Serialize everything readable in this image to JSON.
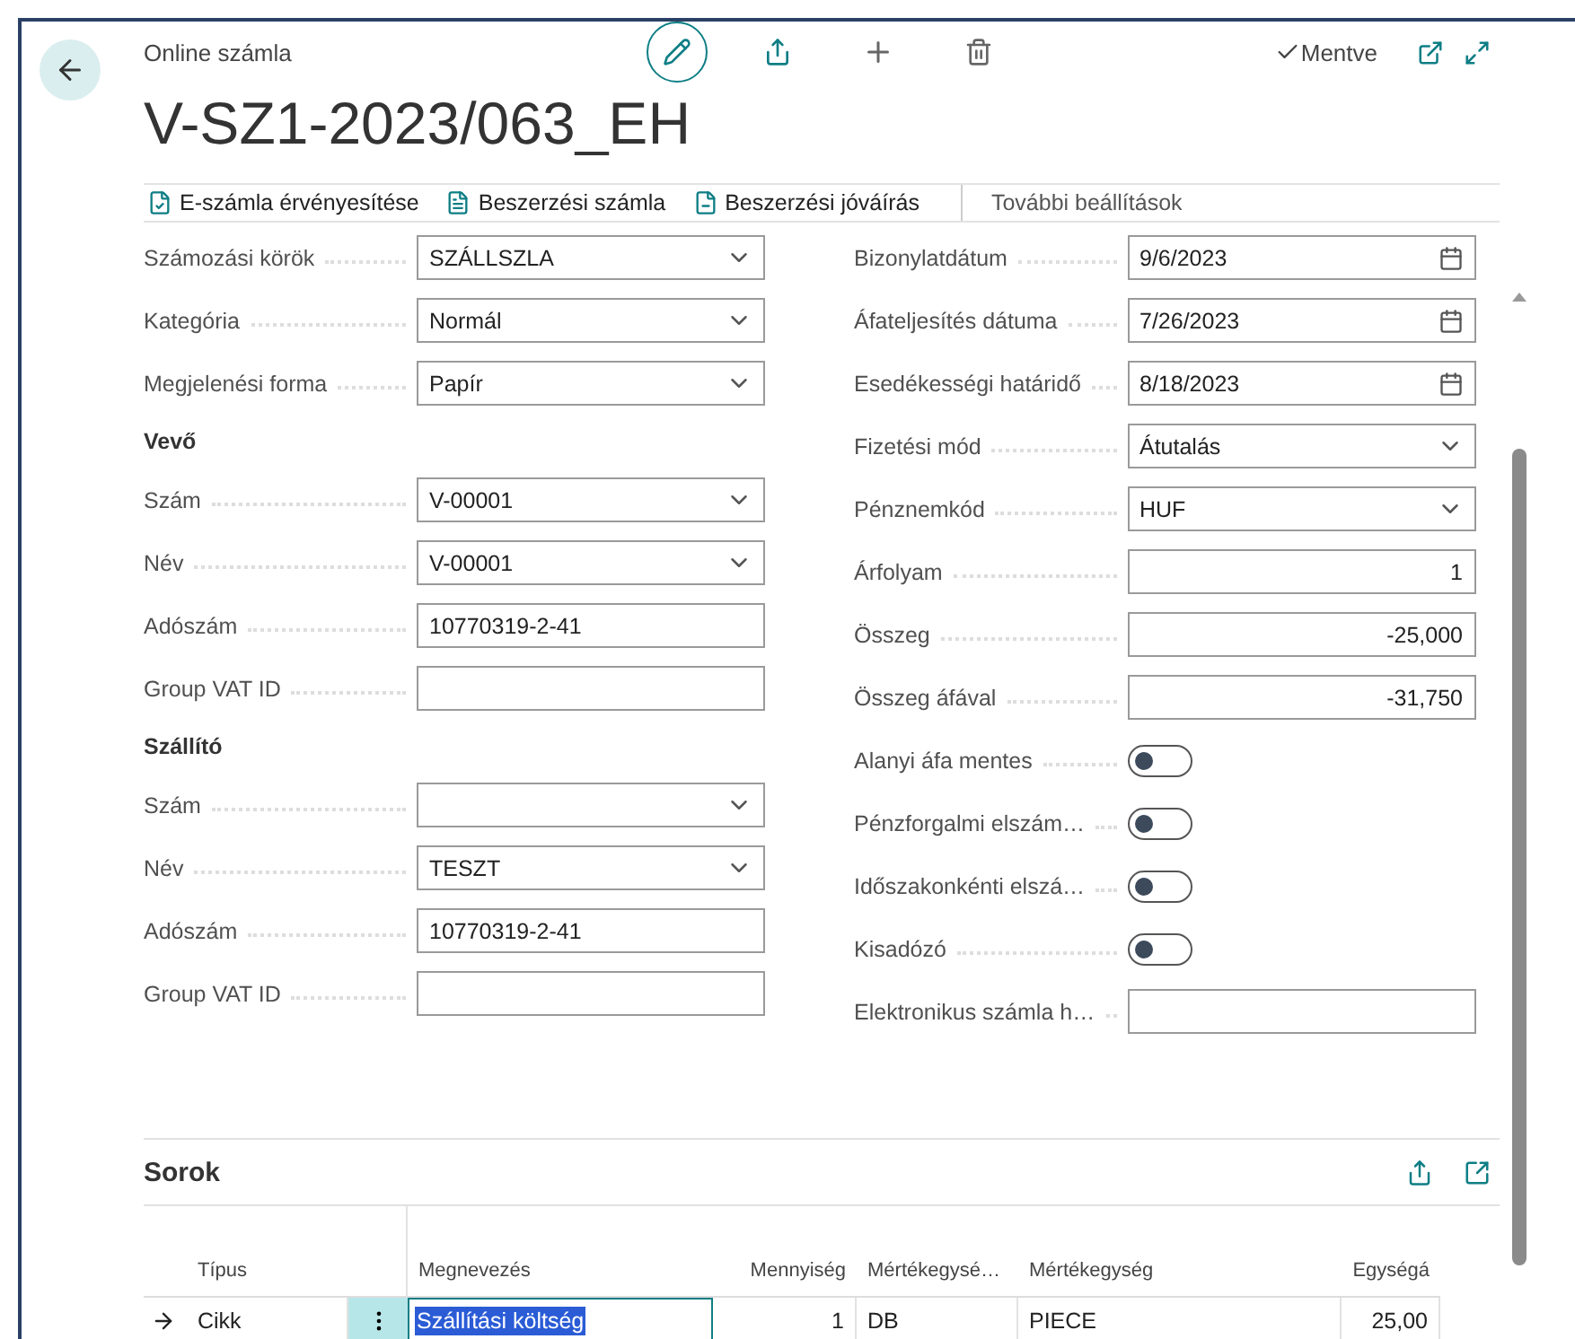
{
  "header": {
    "breadcrumb": "Online számla",
    "title": "V-SZ1-2023/063_EH",
    "status": "Mentve"
  },
  "actions": [
    {
      "kind": "validate",
      "label": "E-számla érvényesítése"
    },
    {
      "kind": "invoice",
      "label": "Beszerzési számla"
    },
    {
      "kind": "credit",
      "label": "Beszerzési jóváírás"
    },
    {
      "kind": "more",
      "label": "További beállítások"
    }
  ],
  "left_fields": [
    {
      "kind": "select",
      "label": "Számozási körök",
      "value": "SZÁLLSZLA"
    },
    {
      "kind": "select",
      "label": "Kategória",
      "value": "Normál"
    },
    {
      "kind": "select",
      "label": "Megjelenési forma",
      "value": "Papír"
    },
    {
      "kind": "heading",
      "label": "Vevő"
    },
    {
      "kind": "select",
      "label": "Szám",
      "value": "V-00001"
    },
    {
      "kind": "select",
      "label": "Név",
      "value": "V-00001"
    },
    {
      "kind": "text",
      "label": "Adószám",
      "value": "10770319-2-41"
    },
    {
      "kind": "text",
      "label": "Group VAT ID"
    },
    {
      "kind": "heading",
      "label": "Szállító"
    },
    {
      "kind": "select",
      "label": "Szám"
    },
    {
      "kind": "select",
      "label": "Név",
      "value": "TESZT"
    },
    {
      "kind": "text",
      "label": "Adószám",
      "value": "10770319-2-41"
    },
    {
      "kind": "text",
      "label": "Group VAT ID"
    }
  ],
  "right_fields": [
    {
      "kind": "date",
      "label": "Bizonylatdátum",
      "value": "9/6/2023"
    },
    {
      "kind": "date",
      "label": "Áfateljesítés dátuma",
      "value": "7/26/2023"
    },
    {
      "kind": "date",
      "label": "Esedékességi határidő",
      "value": "8/18/2023"
    },
    {
      "kind": "select",
      "label": "Fizetési mód",
      "value": "Átutalás"
    },
    {
      "kind": "select",
      "label": "Pénznemkód",
      "value": "HUF"
    },
    {
      "kind": "number",
      "label": "Árfolyam",
      "value": "1"
    },
    {
      "kind": "number",
      "label": "Összeg",
      "value": "-25,000"
    },
    {
      "kind": "number",
      "label": "Összeg áfával",
      "value": "-31,750"
    },
    {
      "kind": "toggle",
      "label": "Alanyi áfa mentes",
      "on": false
    },
    {
      "kind": "toggle",
      "label": "Pénzforgalmi elszám…",
      "on": false
    },
    {
      "kind": "toggle",
      "label": "Időszakonkénti elszá…",
      "on": false
    },
    {
      "kind": "toggle",
      "label": "Kisadózó",
      "on": false
    },
    {
      "kind": "text",
      "label": "Elektronikus számla h…"
    }
  ],
  "lines": {
    "title": "Sorok",
    "columns": [
      "Típus",
      "Megnevezés",
      "Mennyiség",
      "Mértékegysé…",
      "Mértékegység",
      "Egységá"
    ],
    "rows": [
      {
        "selected": true,
        "cells": [
          "Cikk",
          "Szállítási költség",
          "1",
          "DB",
          "PIECE",
          "25,00"
        ]
      }
    ]
  }
}
